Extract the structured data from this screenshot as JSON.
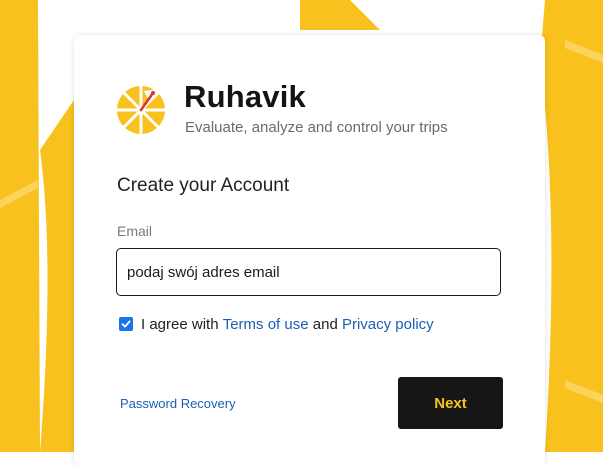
{
  "brand": {
    "name": "Ruhavik",
    "tagline": "Evaluate, analyze and control your trips",
    "logo_icon": "pizza-slice-wheel-icon"
  },
  "form": {
    "heading": "Create your Account",
    "email_label": "Email",
    "email_value": "podaj swój adres email",
    "agree_checked": true,
    "agree_prefix": "I agree with",
    "terms_label": "Terms of use",
    "and_text": "and",
    "privacy_label": "Privacy policy",
    "password_recovery_label": "Password Recovery",
    "next_label": "Next"
  },
  "colors": {
    "background_yellow": "#f8c11d",
    "card": "#ffffff",
    "button_bg": "#161616",
    "button_text": "#f5c518",
    "link": "#1a5fb4",
    "checkbox": "#1a73e8"
  }
}
